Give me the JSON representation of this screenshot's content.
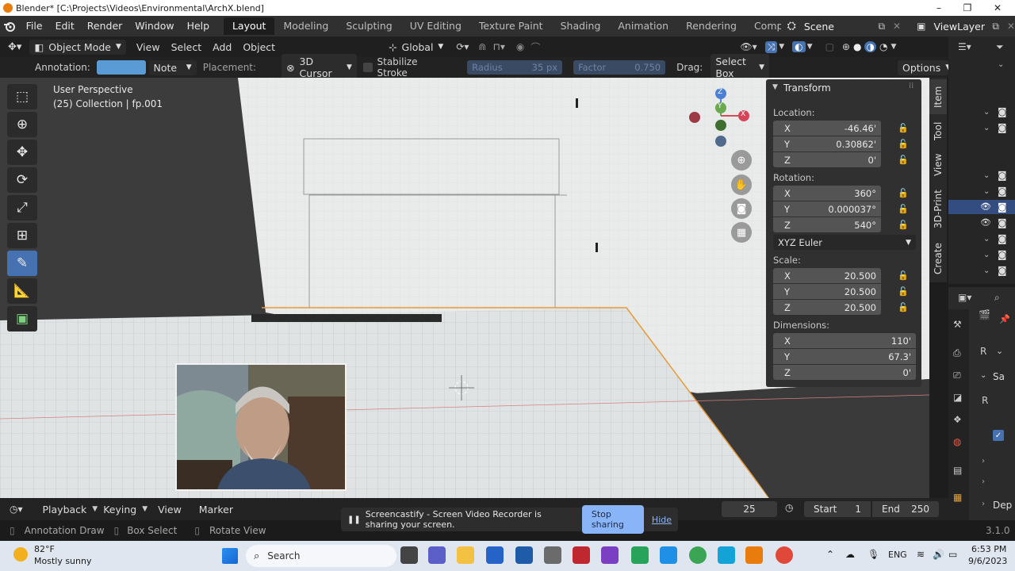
{
  "window": {
    "title": "Blender* [C:\\Projects\\Videos\\Environmental\\ArchX.blend]",
    "minimize": "–",
    "maximize": "❐",
    "close": "✕"
  },
  "menubar": {
    "items": [
      "File",
      "Edit",
      "Render",
      "Window",
      "Help"
    ],
    "workspaces": [
      "Layout",
      "Modeling",
      "Sculpting",
      "UV Editing",
      "Texture Paint",
      "Shading",
      "Animation",
      "Rendering",
      "Compo"
    ],
    "active_workspace": "Layout",
    "scene": "Scene",
    "view_layer": "ViewLayer"
  },
  "header": {
    "mode": "Object Mode",
    "menus": [
      "View",
      "Select",
      "Add",
      "Object"
    ],
    "transform_orientation": "Global"
  },
  "tool_settings": {
    "annotation_label": "Annotation:",
    "annotation_color": "#5b9bd5",
    "note": "Note",
    "placement_label": "Placement:",
    "placement": "3D Cursor",
    "stabilize": "Stabilize Stroke",
    "radius_label": "Radius",
    "radius_value": "35 px",
    "factor_label": "Factor",
    "factor_value": "0.750",
    "drag_label": "Drag:",
    "drag_value": "Select Box",
    "options": "Options"
  },
  "viewport": {
    "perspective": "User Perspective",
    "collection": "(25) Collection | fp.001",
    "gizmo_axes": [
      "Z",
      "Y",
      "X"
    ]
  },
  "transform_panel": {
    "title": "Transform",
    "location_label": "Location:",
    "location": [
      [
        "X",
        "-46.46'"
      ],
      [
        "Y",
        "0.30862'"
      ],
      [
        "Z",
        "0'"
      ]
    ],
    "rotation_label": "Rotation:",
    "rotation": [
      [
        "X",
        "360°"
      ],
      [
        "Y",
        "0.000037°"
      ],
      [
        "Z",
        "540°"
      ]
    ],
    "rotation_mode": "XYZ Euler",
    "scale_label": "Scale:",
    "scale": [
      [
        "X",
        "20.500"
      ],
      [
        "Y",
        "20.500"
      ],
      [
        "Z",
        "20.500"
      ]
    ],
    "dimensions_label": "Dimensions:",
    "dimensions": [
      [
        "X",
        "110'"
      ],
      [
        "Y",
        "67.3'"
      ],
      [
        "Z",
        "0'"
      ]
    ]
  },
  "side_tabs": [
    "Item",
    "Tool",
    "View",
    "3D-Print",
    "Create"
  ],
  "properties": {
    "r_label": "R",
    "sa_label": "Sa",
    "r2_label": "R",
    "dep_label": "Dep"
  },
  "timeline": {
    "menus": [
      "Playback",
      "Keying",
      "View",
      "Marker"
    ],
    "current_frame": "25",
    "start_label": "Start",
    "start": "1",
    "end_label": "End",
    "end": "250"
  },
  "statusbar": {
    "items": [
      "Annotation Draw",
      "Box Select",
      "Rotate View"
    ],
    "version": "3.1.0"
  },
  "share_bar": {
    "message": "Screencastify - Screen Video Recorder is sharing your screen.",
    "stop": "Stop sharing",
    "hide": "Hide"
  },
  "taskbar": {
    "temperature": "82°F",
    "weather": "Mostly sunny",
    "search": "Search",
    "language": "ENG",
    "time": "6:53 PM",
    "date": "9/6/2023"
  }
}
